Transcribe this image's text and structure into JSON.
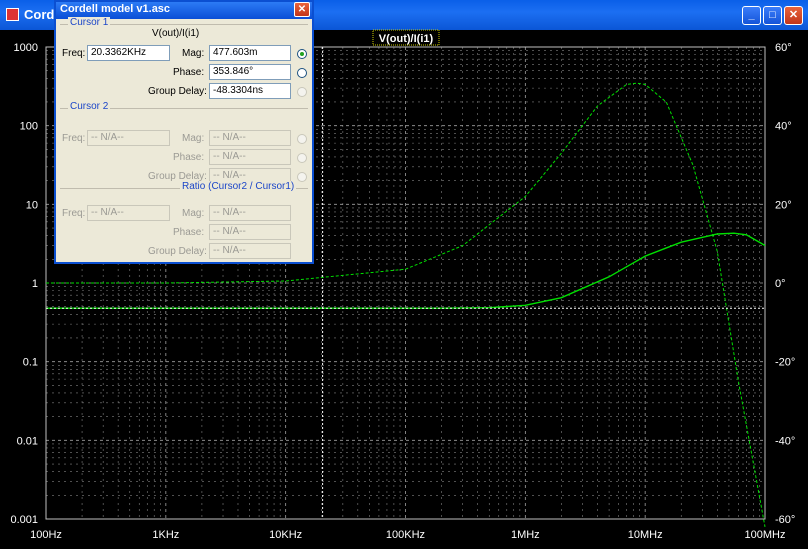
{
  "window": {
    "title": "Cordell model v1.asc"
  },
  "trace_label": "V(out)/I(i1)",
  "x_ticks": [
    "100Hz",
    "1KHz",
    "10KHz",
    "100KHz",
    "1MHz",
    "10MHz",
    "100MHz"
  ],
  "y_left_ticks": [
    "1000",
    "100",
    "10",
    "1",
    "0.1",
    "0.01",
    "0.001"
  ],
  "y_right_ticks": [
    "60°",
    "40°",
    "20°",
    "0°",
    "-20°",
    "-40°",
    "-60°"
  ],
  "colors": {
    "trace": "#00e000",
    "grid": "#808080",
    "cursor": "#ffffff",
    "background": "#000000"
  },
  "dialog": {
    "title": "Cordell model v1.asc",
    "cursor1": {
      "group": "Cursor 1",
      "expression": "V(out)/I(i1)",
      "freq_label": "Freq:",
      "freq": "20.3362KHz",
      "mag_label": "Mag:",
      "mag": "477.603m",
      "phase_label": "Phase:",
      "phase": "353.846°",
      "gd_label": "Group Delay:",
      "gd": "-48.3304ns"
    },
    "cursor2": {
      "group": "Cursor 2",
      "freq_label": "Freq:",
      "freq": "-- N/A--",
      "mag_label": "Mag:",
      "mag": "-- N/A--",
      "phase_label": "Phase:",
      "phase": "-- N/A--",
      "gd_label": "Group Delay:",
      "gd": "-- N/A--"
    },
    "ratio": {
      "group": "Ratio (Cursor2 / Cursor1)",
      "freq_label": "Freq:",
      "freq": "-- N/A--",
      "mag_label": "Mag:",
      "mag": "-- N/A--",
      "phase_label": "Phase:",
      "phase": "-- N/A--",
      "gd_label": "Group Delay:",
      "gd": "-- N/A--"
    }
  },
  "chart_data": {
    "type": "line",
    "x_scale": "log",
    "y_scale": "log",
    "xlim_hz": [
      100,
      100000000
    ],
    "ylim": [
      0.001,
      1000
    ],
    "y2lim_deg": [
      -60,
      60
    ],
    "grid": true,
    "cursor1_freq_hz": 20336.2,
    "series": [
      {
        "name": "V(out)/I(i1)",
        "axis": "magnitude",
        "style": "solid",
        "x": [
          100,
          1000,
          10000,
          100000,
          200000,
          500000,
          1000000,
          2000000,
          5000000,
          10000000,
          20000000,
          40000000,
          55000000,
          70000000,
          100000000
        ],
        "y": [
          0.4776,
          0.4776,
          0.4776,
          0.4776,
          0.478,
          0.485,
          0.52,
          0.65,
          1.2,
          2.2,
          3.3,
          4.2,
          4.3,
          4.1,
          3.0
        ]
      },
      {
        "name": "V(out)/I(i1)",
        "axis": "phase_deg",
        "style": "dashed",
        "x": [
          100,
          1000,
          10000,
          100000,
          300000,
          1000000,
          2000000,
          4000000,
          7000000,
          8500000,
          10000000,
          15000000,
          25000000,
          40000000,
          60000000,
          100000000
        ],
        "y": [
          0.0,
          0.0,
          0.5,
          3.5,
          9.5,
          22.0,
          33.0,
          45.0,
          50.5,
          50.8,
          50.5,
          46.0,
          30.0,
          8.0,
          -25.0,
          -62.0
        ]
      }
    ]
  }
}
